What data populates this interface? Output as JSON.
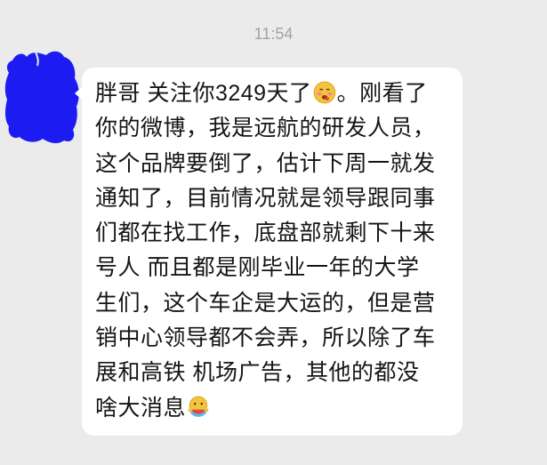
{
  "chat": {
    "timestamp": "11:54",
    "avatar": {
      "icon": "redacted-avatar-scribble-icon",
      "color": "#1c1cf2"
    },
    "message": {
      "first_line": {
        "before_emoji": "胖哥 关注你3249天了",
        "emoji": "drooling-face-icon",
        "after_emoji": "。刚看了"
      },
      "middle_lines": [
        "你的微博，我是远航的研发人员，",
        "这个品牌要倒了，估计下周一就发",
        "通知了，目前情况就是领导跟同事",
        "们都在找工作，底盘部就剩下十来",
        "号人 而且都是刚毕业一年的大学",
        "生们，这个车企是大运的，但是营",
        "销中心领导都不会弄，所以除了车",
        "展和高铁 机场广告，其他的都没"
      ],
      "last_line": {
        "text": "啥大消息",
        "emoji": "eating-melon-icon"
      }
    }
  },
  "colors": {
    "background": "#ebebeb",
    "bubble": "#ffffff",
    "text": "#151515",
    "timestamp": "#a3a3a3"
  }
}
